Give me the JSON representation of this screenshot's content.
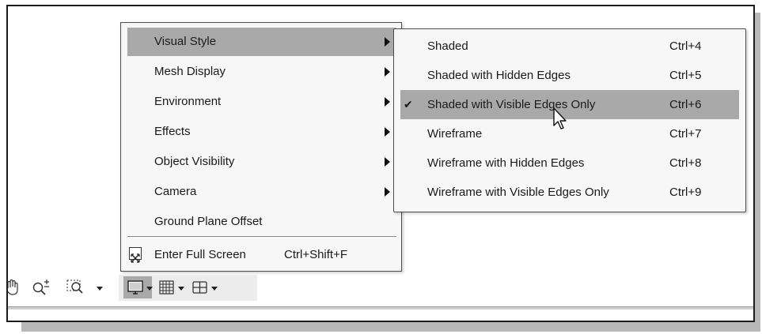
{
  "menu": {
    "items": [
      {
        "label": "Visual Style",
        "highlighted": true,
        "has_submenu": true
      },
      {
        "label": "Mesh Display",
        "highlighted": false,
        "has_submenu": true
      },
      {
        "label": "Environment",
        "highlighted": false,
        "has_submenu": true
      },
      {
        "label": "Effects",
        "highlighted": false,
        "has_submenu": true
      },
      {
        "label": "Object Visibility",
        "highlighted": false,
        "has_submenu": true
      },
      {
        "label": "Camera",
        "highlighted": false,
        "has_submenu": true
      },
      {
        "label": "Ground Plane Offset",
        "highlighted": false,
        "has_submenu": false
      }
    ],
    "full_screen": {
      "label": "Enter Full Screen",
      "shortcut": "Ctrl+Shift+F",
      "icon": "full-screen-icon"
    }
  },
  "submenu": {
    "items": [
      {
        "label": "Shaded",
        "shortcut": "Ctrl+4",
        "checked": false,
        "highlighted": false
      },
      {
        "label": "Shaded with Hidden Edges",
        "shortcut": "Ctrl+5",
        "checked": false,
        "highlighted": false
      },
      {
        "label": "Shaded with Visible Edges Only",
        "shortcut": "Ctrl+6",
        "checked": true,
        "highlighted": true
      },
      {
        "label": "Wireframe",
        "shortcut": "Ctrl+7",
        "checked": false,
        "highlighted": false
      },
      {
        "label": "Wireframe with Hidden Edges",
        "shortcut": "Ctrl+8",
        "checked": false,
        "highlighted": false
      },
      {
        "label": "Wireframe with Visible Edges Only",
        "shortcut": "Ctrl+9",
        "checked": false,
        "highlighted": false
      }
    ],
    "check_glyph": "✔"
  },
  "toolbar": {
    "icons": [
      "pan-hand-icon",
      "zoom-icon",
      "zoom-window-icon",
      "display-settings-icon",
      "grid-icon",
      "viewports-icon"
    ],
    "active": "display-settings-icon"
  },
  "colors": {
    "highlight": "#a9a9a9",
    "menu_bg": "#f7f7f7",
    "border": "#4d4d4d"
  }
}
